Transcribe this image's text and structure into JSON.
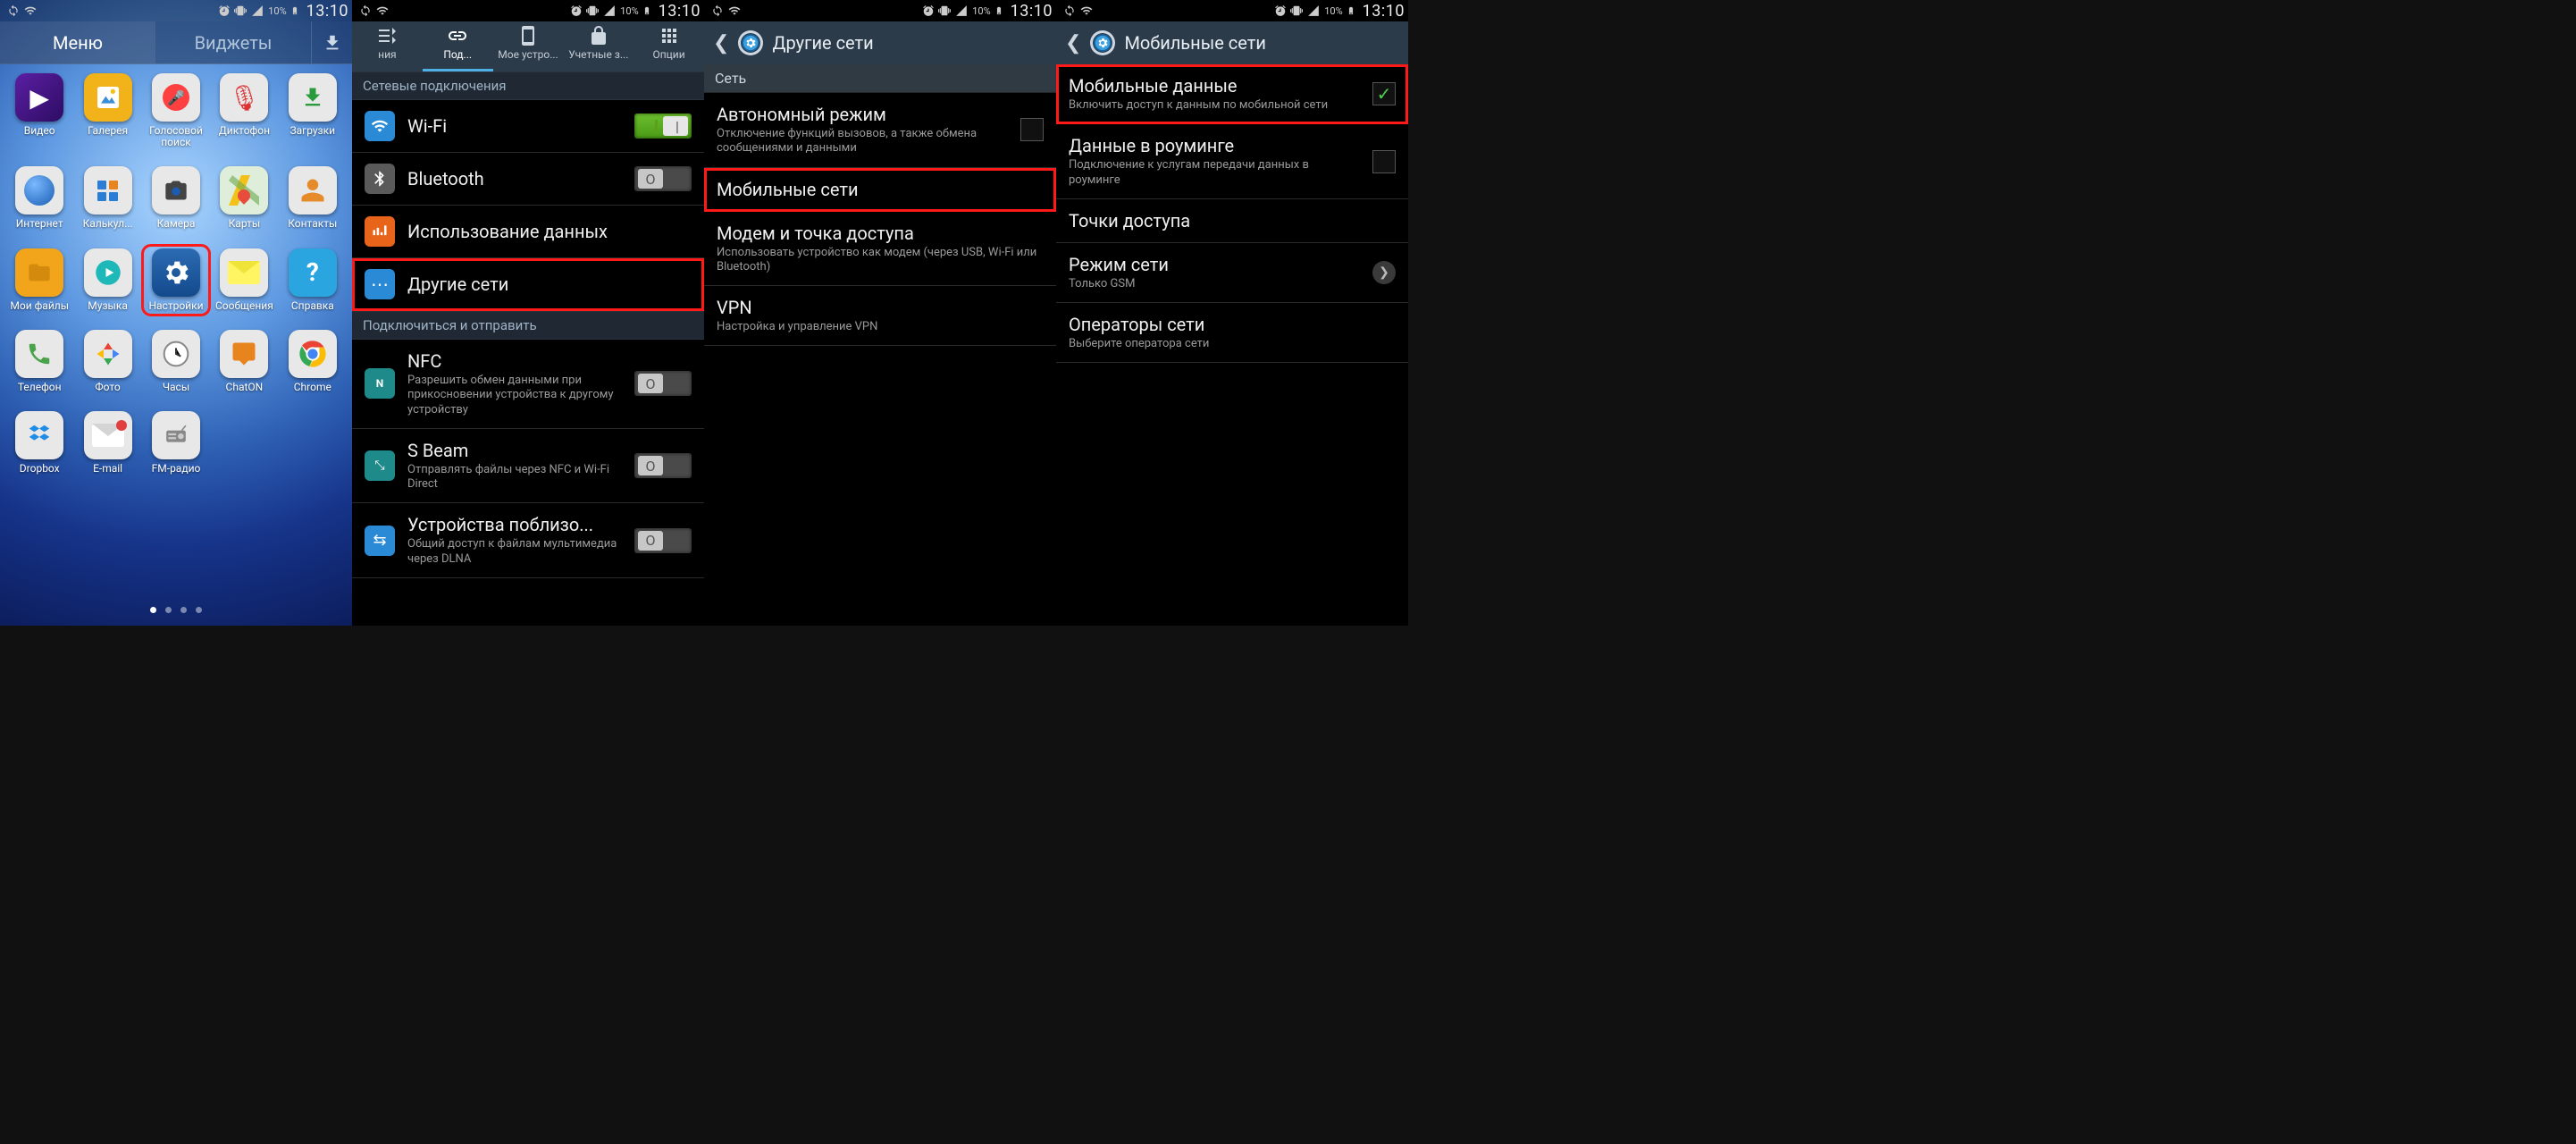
{
  "status": {
    "time": "13:10",
    "battery": "10%"
  },
  "screen1": {
    "tabs": {
      "menu": "Меню",
      "widgets": "Виджеты"
    },
    "apps": [
      {
        "id": "video",
        "label": "Видео"
      },
      {
        "id": "gallery",
        "label": "Галерея"
      },
      {
        "id": "voice",
        "label": "Голосовой\nпоиск"
      },
      {
        "id": "recorder",
        "label": "Диктофон"
      },
      {
        "id": "downloads",
        "label": "Загрузки"
      },
      {
        "id": "internet",
        "label": "Интернет"
      },
      {
        "id": "calc",
        "label": "Калькул..."
      },
      {
        "id": "camera",
        "label": "Камера"
      },
      {
        "id": "maps",
        "label": "Карты"
      },
      {
        "id": "contacts",
        "label": "Контакты"
      },
      {
        "id": "files",
        "label": "Мои файлы"
      },
      {
        "id": "music",
        "label": "Музыка"
      },
      {
        "id": "settings",
        "label": "Настройки"
      },
      {
        "id": "messages",
        "label": "Сообщения"
      },
      {
        "id": "help",
        "label": "Справка"
      },
      {
        "id": "phone",
        "label": "Телефон"
      },
      {
        "id": "photos",
        "label": "Фото"
      },
      {
        "id": "clock",
        "label": "Часы"
      },
      {
        "id": "chaton",
        "label": "ChatON"
      },
      {
        "id": "chrome",
        "label": "Chrome"
      },
      {
        "id": "dropbox",
        "label": "Dropbox"
      },
      {
        "id": "email",
        "label": "E-mail"
      },
      {
        "id": "radio",
        "label": "FM-радио"
      }
    ],
    "highlight": "settings"
  },
  "screen2": {
    "tabs": [
      "ния",
      "Под...",
      "Мое устро...",
      "Учетные з...",
      "Опции"
    ],
    "section1": "Сетевые подключения",
    "items1": [
      {
        "id": "wifi",
        "title": "Wi-Fi",
        "switch": "on"
      },
      {
        "id": "bt",
        "title": "Bluetooth",
        "switch": "off"
      },
      {
        "id": "datausage",
        "title": "Использование данных"
      },
      {
        "id": "more",
        "title": "Другие сети",
        "highlight": true
      }
    ],
    "section2": "Подключиться и отправить",
    "items2": [
      {
        "id": "nfc",
        "title": "NFC",
        "sub": "Разрешить обмен данными при прикосновении устройства к другому устройству",
        "switch": "off"
      },
      {
        "id": "sbeam",
        "title": "S Beam",
        "sub": "Отправлять файлы через NFC и Wi-Fi Direct",
        "switch": "off"
      },
      {
        "id": "nearby",
        "title": "Устройства поблизо...",
        "sub": "Общий доступ к файлам мультимедиа через DLNA",
        "switch": "off"
      }
    ]
  },
  "screen3": {
    "title": "Другие сети",
    "category": "Сеть",
    "items": [
      {
        "id": "airplane",
        "title": "Автономный режим",
        "sub": "Отключение функций вызовов, а также обмена сообщениями и данными",
        "chk": false
      },
      {
        "id": "mobilenets",
        "title": "Мобильные сети",
        "highlight": true
      },
      {
        "id": "tether",
        "title": "Модем и точка доступа",
        "sub": "Использовать устройство как модем (через USB, Wi-Fi или Bluetooth)"
      },
      {
        "id": "vpn",
        "title": "VPN",
        "sub": "Настройка и управление VPN"
      }
    ]
  },
  "screen4": {
    "title": "Мобильные сети",
    "items": [
      {
        "id": "mdata",
        "title": "Мобильные данные",
        "sub": "Включить доступ к данным по мобильной сети",
        "chk": true,
        "highlight": true
      },
      {
        "id": "roam",
        "title": "Данные в роуминге",
        "sub": "Подключение к услугам передачи данных в роуминге",
        "chk": false
      },
      {
        "id": "apn",
        "title": "Точки доступа"
      },
      {
        "id": "netmode",
        "title": "Режим сети",
        "sub": "Только GSM",
        "arrow": true
      },
      {
        "id": "operators",
        "title": "Операторы сети",
        "sub": "Выберите оператора сети"
      }
    ]
  }
}
